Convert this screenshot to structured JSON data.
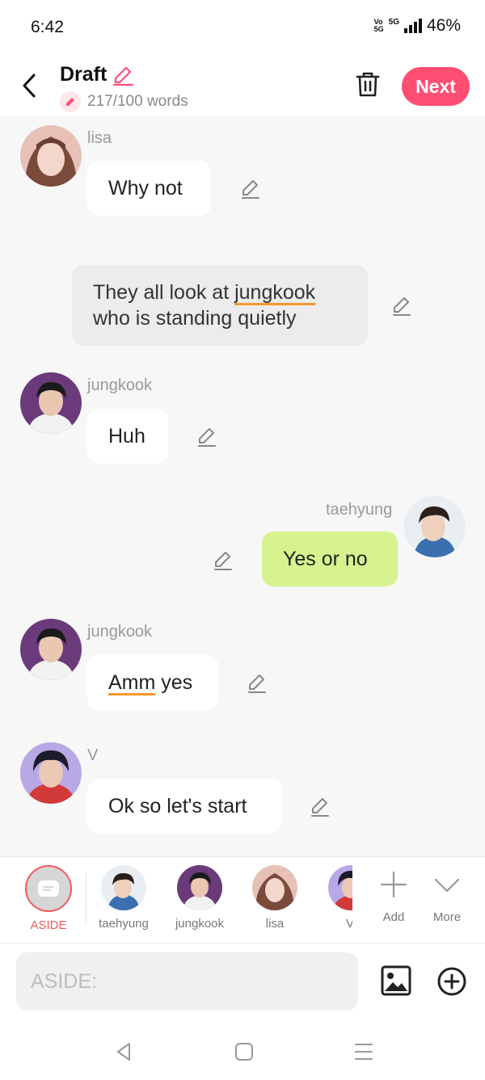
{
  "status": {
    "time": "6:42",
    "volte_top": "Vo",
    "volte_bottom": "5G",
    "network": "5G",
    "battery": "46%"
  },
  "header": {
    "title": "Draft",
    "word_count": "217/100 words",
    "next_label": "Next"
  },
  "colors": {
    "accent": "#ff4d73",
    "green_bubble": "#d6f38f",
    "aside_ring": "#ef5a5a",
    "squiggle": "#f39a2e"
  },
  "messages": [
    {
      "sender": "lisa",
      "text": "Why not",
      "side": "left"
    },
    {
      "type": "narration",
      "text_before": "They all look at ",
      "underlined": "jungkook",
      "text_after": "who is standing quietly"
    },
    {
      "sender": "jungkook",
      "text": "Huh",
      "side": "left"
    },
    {
      "sender": "taehyung",
      "text": "Yes or no",
      "side": "right"
    },
    {
      "sender": "jungkook",
      "underlined": "Amm",
      "text": " yes",
      "side": "left"
    },
    {
      "sender": "V",
      "text": "Ok so let's start",
      "side": "left"
    }
  ],
  "cast": [
    {
      "label": "ASIDE",
      "selected": true
    },
    {
      "label": "taehyung"
    },
    {
      "label": "jungkook"
    },
    {
      "label": "lisa"
    },
    {
      "label": "V"
    },
    {
      "label": "Add",
      "icon": "plus-icon"
    },
    {
      "label": "More",
      "icon": "chevron-down-icon"
    }
  ],
  "composer": {
    "placeholder": "ASIDE:"
  }
}
